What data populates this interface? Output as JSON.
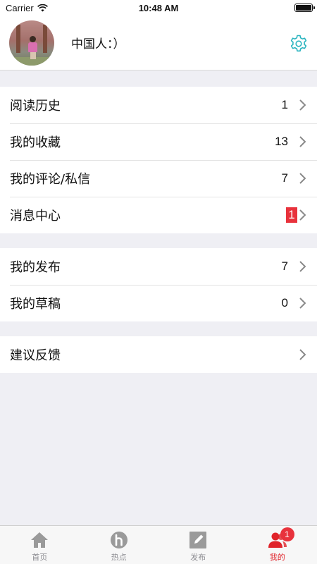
{
  "status_bar": {
    "carrier": "Carrier",
    "time": "10:48 AM"
  },
  "profile": {
    "username": "中国人：）"
  },
  "menu_groups": [
    {
      "items": [
        {
          "label": "阅读历史",
          "count": "1"
        },
        {
          "label": "我的收藏",
          "count": "13"
        },
        {
          "label": "我的评论/私信",
          "count": "7"
        },
        {
          "label": "消息中心",
          "badge": "1"
        }
      ]
    },
    {
      "items": [
        {
          "label": "我的发布",
          "count": "7"
        },
        {
          "label": "我的草稿",
          "count": "0"
        }
      ]
    },
    {
      "items": [
        {
          "label": "建议反馈"
        }
      ]
    }
  ],
  "tabbar": {
    "tabs": [
      {
        "label": "首页",
        "icon": "home-icon"
      },
      {
        "label": "热点",
        "icon": "hot-icon"
      },
      {
        "label": "发布",
        "icon": "publish-icon"
      },
      {
        "label": "我的",
        "icon": "profile-icon",
        "badge": "1",
        "active": true
      }
    ]
  },
  "colors": {
    "accent": "#e0242b",
    "badge": "#e8323c",
    "settings": "#2bb5c0",
    "background": "#efeff4"
  }
}
